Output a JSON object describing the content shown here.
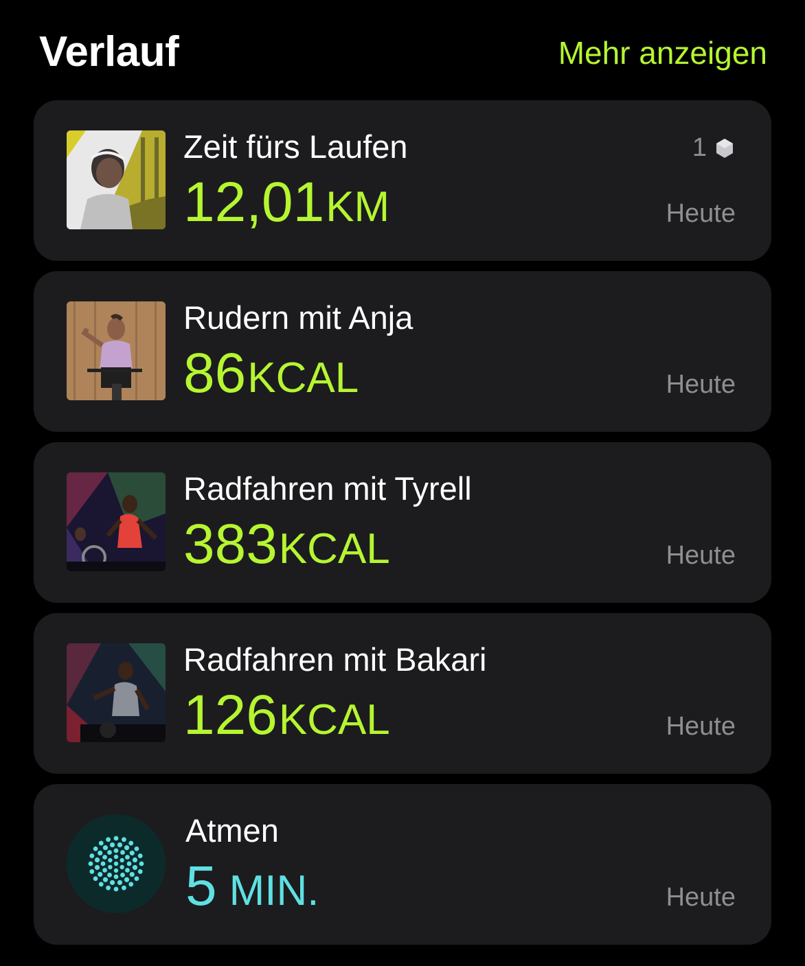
{
  "header": {
    "title": "Verlauf",
    "more_label": "Mehr anzeigen"
  },
  "colors": {
    "accent_green": "#b6f531",
    "accent_cyan": "#5fe0e3",
    "card_bg": "#1c1c1e",
    "date_gray": "#8e8e93"
  },
  "workouts": [
    {
      "name": "Zeit fürs Laufen",
      "value": "12,01",
      "unit": "KM",
      "date": "Heute",
      "badge_count": "1",
      "badge_icon": "award-hexagon-icon",
      "thumb": "runner-golden-gate-photo"
    },
    {
      "name": "Rudern mit Anja",
      "value": "86",
      "unit": "KCAL",
      "date": "Heute",
      "thumb": "rowing-trainer-photo"
    },
    {
      "name": "Radfahren mit Tyrell",
      "value": "383",
      "unit": "KCAL",
      "date": "Heute",
      "thumb": "cycling-trainer-photo"
    },
    {
      "name": "Radfahren mit Bakari",
      "value": "126",
      "unit": "KCAL",
      "date": "Heute",
      "thumb": "cycling-trainer-photo"
    },
    {
      "name": "Atmen",
      "value": "5",
      "unit": "MIN.",
      "date": "Heute",
      "thumb": "breathe-flower-icon"
    }
  ]
}
